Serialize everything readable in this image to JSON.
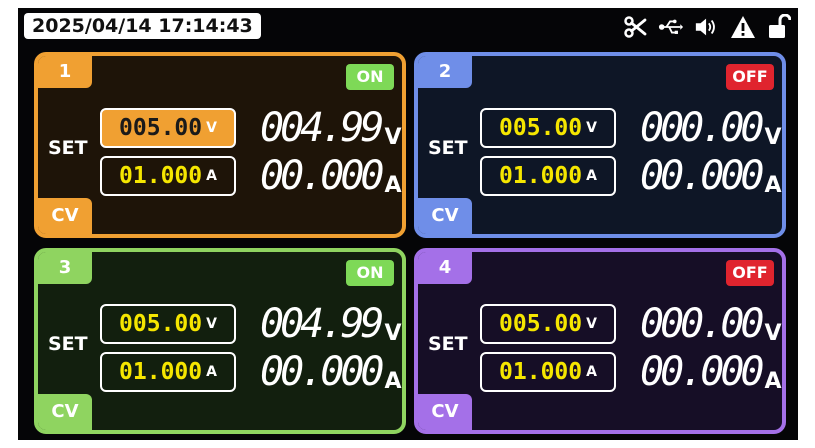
{
  "status": {
    "datetime": "2025/04/14 17:14:43",
    "icons": [
      "scissors-icon",
      "usb-icon",
      "speaker-icon",
      "warning-icon",
      "unlock-icon"
    ]
  },
  "theme": {
    "on_color": "#7ed957",
    "off_color": "#e0242e"
  },
  "channels": [
    {
      "number": "1",
      "state": "ON",
      "mode": "CV",
      "set_label": "SET",
      "set_voltage": "005.00",
      "set_voltage_unit": "V",
      "set_current": "01.000",
      "set_current_unit": "A",
      "meas_voltage": "004.99",
      "meas_voltage_unit": "V",
      "meas_current": "00.000",
      "meas_current_unit": "A",
      "accent": "#f0a032",
      "bg": "#1e1408"
    },
    {
      "number": "2",
      "state": "OFF",
      "mode": "CV",
      "set_label": "SET",
      "set_voltage": "005.00",
      "set_voltage_unit": "V",
      "set_current": "01.000",
      "set_current_unit": "A",
      "meas_voltage": "000.00",
      "meas_voltage_unit": "V",
      "meas_current": "00.000",
      "meas_current_unit": "A",
      "accent": "#6f8ee8",
      "bg": "#0e1626"
    },
    {
      "number": "3",
      "state": "ON",
      "mode": "CV",
      "set_label": "SET",
      "set_voltage": "005.00",
      "set_voltage_unit": "V",
      "set_current": "01.000",
      "set_current_unit": "A",
      "meas_voltage": "004.99",
      "meas_voltage_unit": "V",
      "meas_current": "00.000",
      "meas_current_unit": "A",
      "accent": "#8fd460",
      "bg": "#121f0e"
    },
    {
      "number": "4",
      "state": "OFF",
      "mode": "CV",
      "set_label": "SET",
      "set_voltage": "005.00",
      "set_voltage_unit": "V",
      "set_current": "01.000",
      "set_current_unit": "A",
      "meas_voltage": "000.00",
      "meas_voltage_unit": "V",
      "meas_current": "00.000",
      "meas_current_unit": "A",
      "accent": "#a470e8",
      "bg": "#160e26"
    }
  ]
}
